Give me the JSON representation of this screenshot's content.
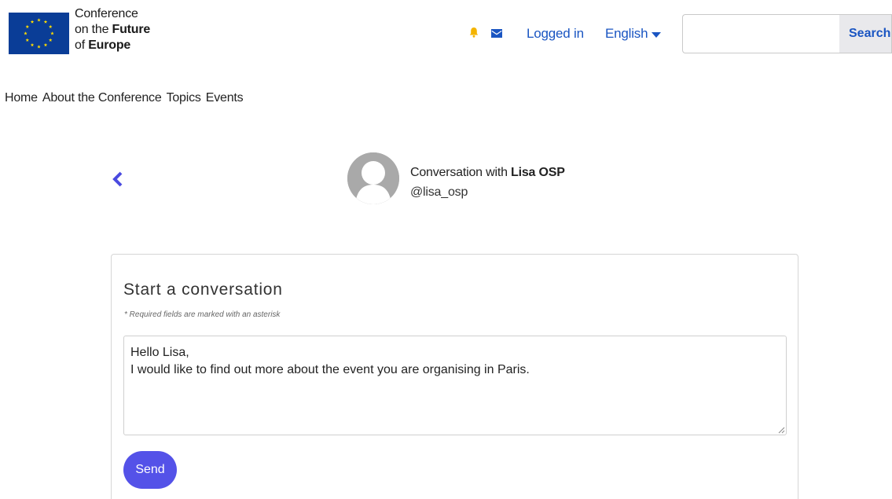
{
  "header": {
    "logo": {
      "line1": "Conference",
      "line2_prefix": "on the ",
      "line2_bold": "Future",
      "line3_prefix": "of ",
      "line3_bold": "Europe"
    },
    "notifications_icon": "bell-icon",
    "messages_icon": "mail-icon",
    "logged_in_label": "Logged in",
    "language_label": "English",
    "search": {
      "placeholder": "",
      "button_label": "Search"
    }
  },
  "nav": {
    "items": [
      "Home",
      "About the Conference",
      "Topics",
      "Events"
    ]
  },
  "conversation": {
    "back_icon": "chevron-left-icon",
    "title_prefix": "Conversation with ",
    "title_name": "Lisa OSP",
    "handle": "@lisa_osp"
  },
  "form": {
    "title": "Start a conversation",
    "required_note": "* Required fields are marked with an asterisk",
    "message_value": "Hello Lisa,\nI would like to find out more about the event you are organising in Paris.",
    "send_label": "Send"
  },
  "colors": {
    "link": "#1a55c2",
    "accent": "#5452e8",
    "bell": "#f4b400",
    "eu_blue": "#0a3d97",
    "eu_star": "#ffdd00"
  }
}
